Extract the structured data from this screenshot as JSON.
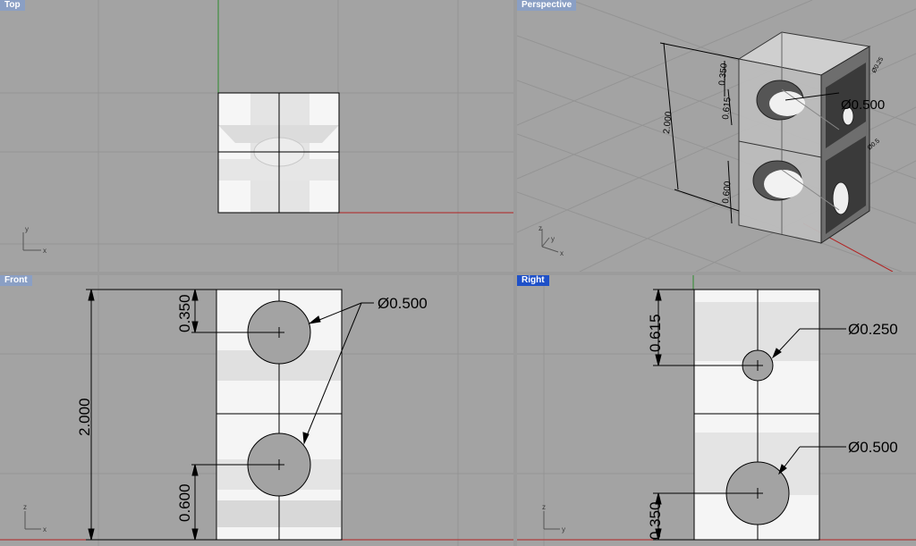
{
  "viewports": {
    "top": {
      "title": "Top"
    },
    "perspective": {
      "title": "Perspective",
      "dims": {
        "height": "2.000",
        "top_offset": "0.350",
        "hole_offset": "0.615",
        "hole_dia": "Ø0.500",
        "bottom_offset": "0.600",
        "small1": "Ø0.25",
        "small2": "Ø0.5"
      }
    },
    "front": {
      "title": "Front",
      "dims": {
        "height": "2.000",
        "top_offset": "0.350",
        "bottom_offset": "0.600",
        "hole_dia": "Ø0.500"
      }
    },
    "right": {
      "title": "Right",
      "dims": {
        "top_offset": "0.615",
        "bottom_offset": "0.350",
        "small_dia": "Ø0.250",
        "large_dia": "Ø0.500"
      }
    }
  },
  "axes": {
    "x": "x",
    "y": "y",
    "z": "z"
  },
  "colors": {
    "viewport_bg": "#a3a3a3",
    "grid": "#8f8f8f",
    "x_axis": "#b22222",
    "y_axis": "#2e8b2e",
    "active_title": "#1e50c8",
    "inactive_title": "#8a9fc4"
  }
}
